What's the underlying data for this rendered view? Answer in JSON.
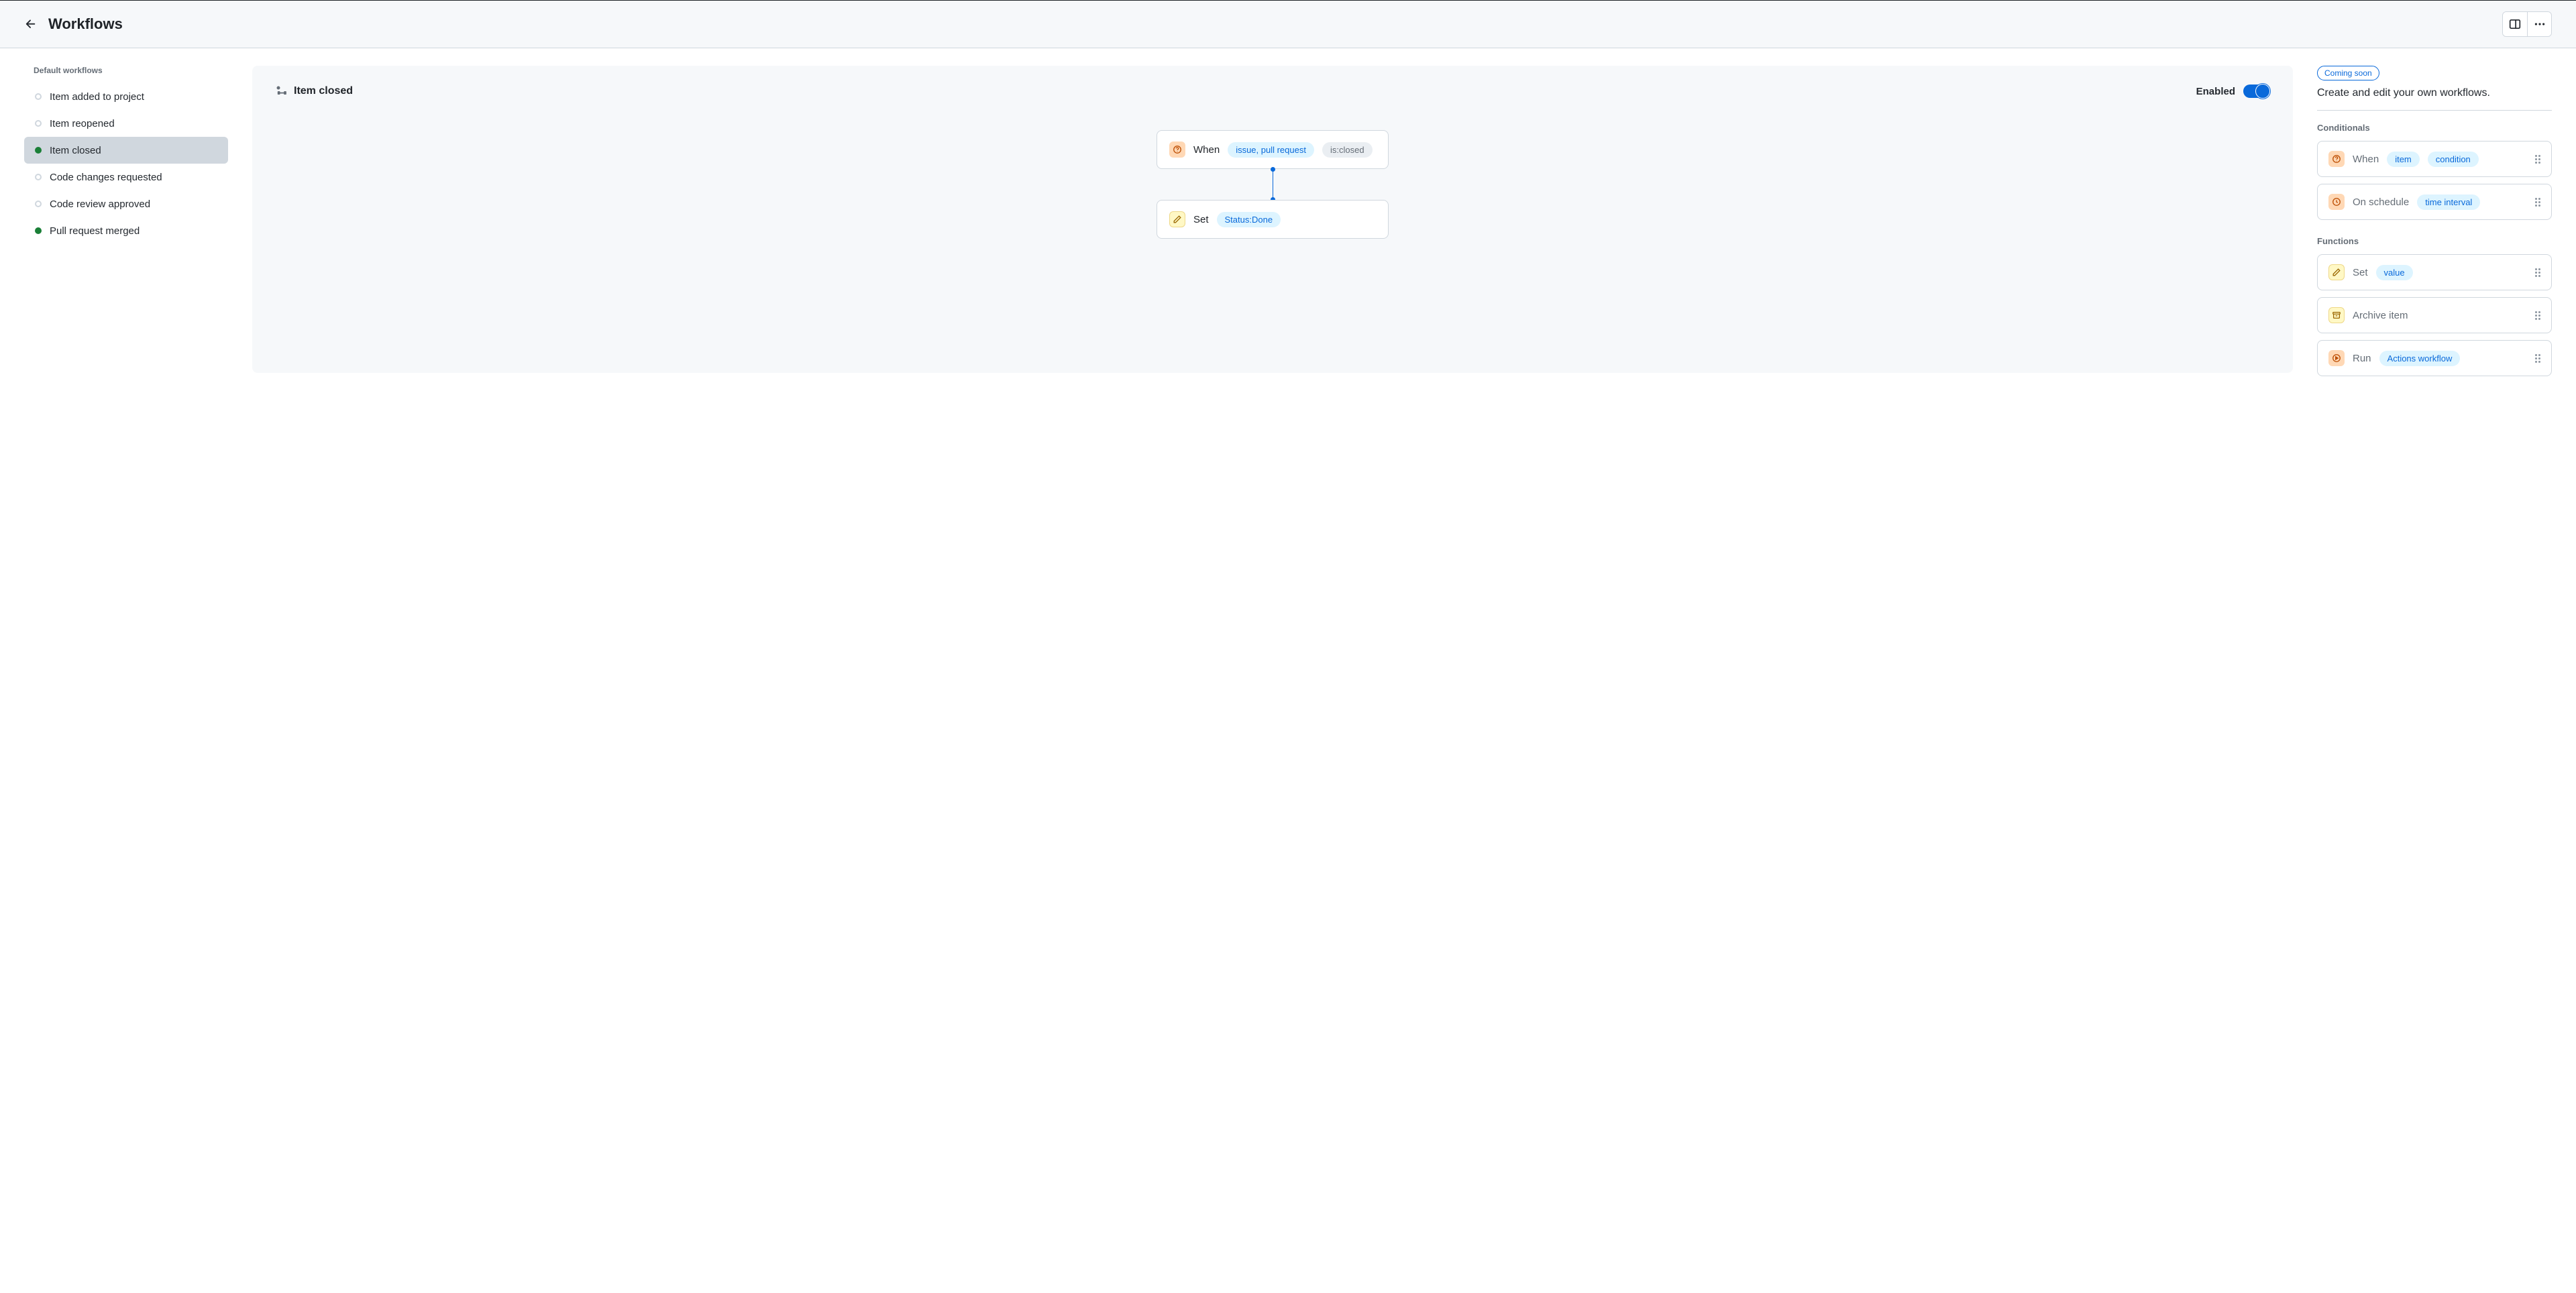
{
  "header": {
    "title": "Workflows"
  },
  "sidebar": {
    "heading": "Default workflows",
    "items": [
      {
        "label": "Item added to project",
        "status": "off",
        "active": false
      },
      {
        "label": "Item reopened",
        "status": "off",
        "active": false
      },
      {
        "label": "Item closed",
        "status": "on",
        "active": true
      },
      {
        "label": "Code changes requested",
        "status": "off",
        "active": false
      },
      {
        "label": "Code review approved",
        "status": "off",
        "active": false
      },
      {
        "label": "Pull request merged",
        "status": "on",
        "active": false
      }
    ]
  },
  "canvas": {
    "title": "Item closed",
    "enabledLabel": "Enabled",
    "nodes": {
      "when": {
        "label": "When",
        "pill1": "issue, pull request",
        "pill2": "is:closed"
      },
      "set": {
        "label": "Set",
        "pill1": "Status:Done"
      }
    }
  },
  "palette": {
    "badge": "Coming soon",
    "desc": "Create and edit your own workflows.",
    "conditionalsHeading": "Conditionals",
    "functionsHeading": "Functions",
    "conditionals": [
      {
        "label": "When",
        "pills": [
          "item",
          "condition"
        ],
        "icon": "question"
      },
      {
        "label": "On schedule",
        "pills": [
          "time interval"
        ],
        "icon": "clock"
      }
    ],
    "functions": [
      {
        "label": "Set",
        "pills": [
          "value"
        ],
        "icon": "pencil"
      },
      {
        "label": "Archive item",
        "pills": [],
        "icon": "archive"
      },
      {
        "label": "Run",
        "pills": [
          "Actions workflow"
        ],
        "icon": "play"
      }
    ]
  }
}
